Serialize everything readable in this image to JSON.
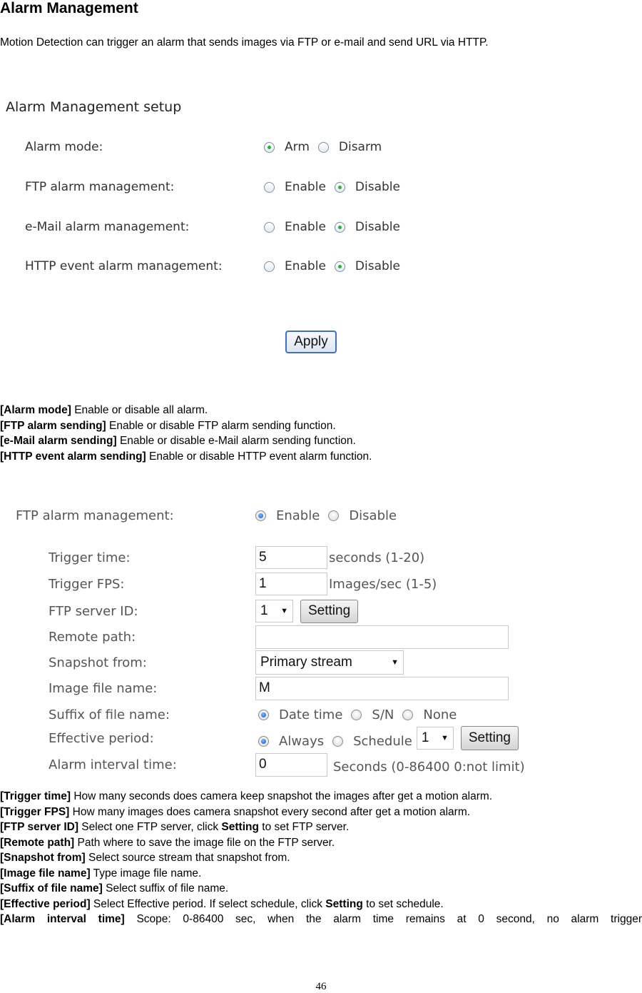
{
  "doc": {
    "title": "Alarm Management",
    "intro": "Motion Detection can trigger an alarm that sends images via FTP or e-mail and send URL via HTTP.",
    "page_number": "46"
  },
  "setup": {
    "heading": "Alarm Management setup",
    "rows": [
      {
        "label": "Alarm mode:",
        "options": [
          "Arm",
          "Disarm"
        ],
        "selected": "Arm"
      },
      {
        "label": "FTP alarm management:",
        "options": [
          "Enable",
          "Disable"
        ],
        "selected": "Disable"
      },
      {
        "label": "e-Mail alarm management:",
        "options": [
          "Enable",
          "Disable"
        ],
        "selected": "Disable"
      },
      {
        "label": "HTTP event alarm management:",
        "options": [
          "Enable",
          "Disable"
        ],
        "selected": "Disable"
      }
    ],
    "apply_label": "Apply"
  },
  "setup_desc": [
    {
      "term": "[Alarm mode]",
      "text": " Enable or disable all alarm."
    },
    {
      "term": "[FTP alarm sending]",
      "text": " Enable or disable FTP alarm sending function."
    },
    {
      "term": "[e-Mail alarm sending]",
      "text": " Enable or disable e-Mail alarm sending function."
    },
    {
      "term": "[HTTP event alarm sending]",
      "text": " Enable or disable HTTP event alarm function."
    }
  ],
  "ftp": {
    "heading_label": "FTP alarm management:",
    "heading_options": [
      "Enable",
      "Disable"
    ],
    "heading_selected": "Enable",
    "trigger_time": {
      "label": "Trigger time:",
      "value": "5",
      "unit": "seconds (1-20)"
    },
    "trigger_fps": {
      "label": "Trigger FPS:",
      "value": "1",
      "unit": "Images/sec (1-5)"
    },
    "server_id": {
      "label": "FTP server ID:",
      "value": "1",
      "button": "Setting"
    },
    "remote_path": {
      "label": "Remote path:",
      "value": ""
    },
    "snapshot_from": {
      "label": "Snapshot from:",
      "value": "Primary stream"
    },
    "image_file_name": {
      "label": "Image file name:",
      "value": "M"
    },
    "suffix": {
      "label": "Suffix of file name:",
      "options": [
        "Date time",
        "S/N",
        "None"
      ],
      "selected": "Date time"
    },
    "effective_period": {
      "label": "Effective period:",
      "options": [
        "Always",
        "Schedule"
      ],
      "selected": "Always",
      "schedule_value": "1",
      "button": "Setting"
    },
    "alarm_interval": {
      "label": "Alarm interval time:",
      "value": "0",
      "unit": "Seconds (0-86400 0:not limit)"
    }
  },
  "ftp_desc": [
    {
      "term": "[Trigger time]",
      "text": " How many seconds does camera keep snapshot the images after get a motion alarm."
    },
    {
      "term": "[Trigger FPS]",
      "text": " How many images does camera snapshot every second after get a motion alarm."
    },
    {
      "term": "[FTP server ID]",
      "text": " Select one FTP server, click ",
      "bold2": "Setting",
      "text2": " to set FTP server."
    },
    {
      "term": "[Remote path]",
      "text": " Path where to save the image file on the FTP server."
    },
    {
      "term": "[Snapshot from]",
      "text": " Select source stream that snapshot from."
    },
    {
      "term": "[Image file name]",
      "text": " Type image file name."
    },
    {
      "term": "[Suffix of file name]",
      "text": " Select suffix of file name."
    },
    {
      "term": "[Effective period]",
      "text": " Select Effective period. If select schedule, click ",
      "bold2": "Setting",
      "text2": " to set schedule."
    },
    {
      "term": "[Alarm interval time]",
      "text": " Scope: 0-86400 sec, when the alarm time remains at 0 second, no alarm trigger"
    }
  ]
}
